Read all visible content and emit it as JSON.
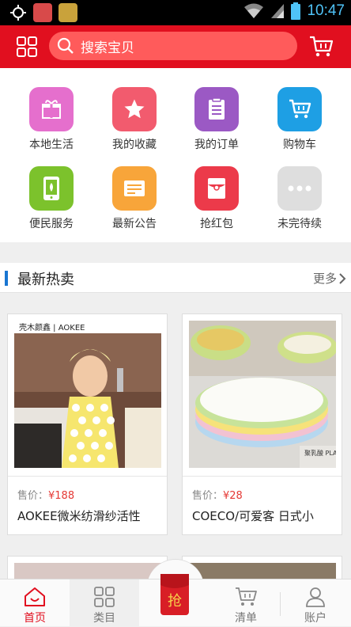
{
  "status_bar": {
    "time": "10:47"
  },
  "header": {
    "search_placeholder": "搜索宝贝"
  },
  "menu": [
    {
      "label": "本地生活",
      "color": "#e56fcd",
      "icon": "gift-icon"
    },
    {
      "label": "我的收藏",
      "color": "#f25b6e",
      "icon": "star-icon"
    },
    {
      "label": "我的订单",
      "color": "#9b59c4",
      "icon": "order-list-icon"
    },
    {
      "label": "购物车",
      "color": "#1e9fe4",
      "icon": "cart-icon"
    },
    {
      "label": "便民服务",
      "color": "#7cc22c",
      "icon": "phone-icon"
    },
    {
      "label": "最新公告",
      "color": "#f8a53a",
      "icon": "notice-icon"
    },
    {
      "label": "抢红包",
      "color": "#ec3a4a",
      "icon": "red-packet-icon"
    },
    {
      "label": "未完待续",
      "color": "#dedede",
      "icon": "more-dots-icon"
    }
  ],
  "section": {
    "title": "最新热卖",
    "more": "更多"
  },
  "products": [
    {
      "price_label": "售价：",
      "price": "¥188",
      "name": "AOKEE微米纺滑纱活性",
      "brand_text": "壳木颜鑫 | AOKEE"
    },
    {
      "price_label": "售价：",
      "price": "¥28",
      "name": "COECO/可爱客 日式小",
      "brand_text": "聚乳酸 PLA"
    }
  ],
  "tabbar": {
    "tabs": [
      {
        "label": "首页",
        "icon": "home-icon",
        "active": true
      },
      {
        "label": "类目",
        "icon": "category-grid-icon",
        "active": false
      },
      {
        "label": "清单",
        "icon": "cart-icon",
        "active": false
      },
      {
        "label": "账户",
        "icon": "user-icon",
        "active": false
      }
    ],
    "center_label": "抢"
  },
  "colors": {
    "brand_red": "#e10f1f",
    "accent_blue": "#1976d2",
    "price_red": "#e53935"
  }
}
